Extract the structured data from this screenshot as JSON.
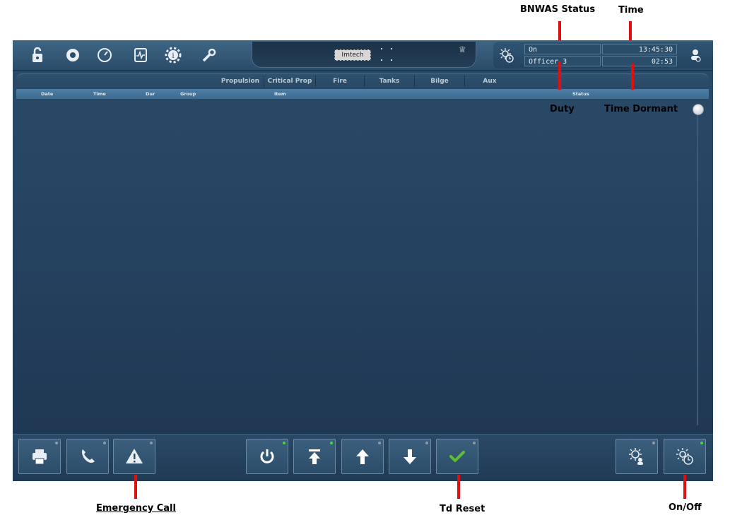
{
  "annotations": {
    "bnwas_status": "BNWAS Status",
    "time": "Time",
    "duty": "Duty",
    "time_dormant": "Time Dormant",
    "emergency_call": "Emergency Call",
    "td_reset": "Td Reset",
    "on_off": "On/Off"
  },
  "topbar": {
    "icons": [
      "unlock-icon",
      "eye-settings-icon",
      "gauge-icon",
      "diagnostics-icon",
      "info-gear-icon",
      "wrench-settings-icon"
    ],
    "logo_label": "Imtech",
    "status": {
      "bnwas_state": "On",
      "duty_officer": "Officer 3",
      "clock": "13:45:30",
      "time_dormant": "02:53"
    }
  },
  "tabs": [
    "Propulsion",
    "Critical Prop",
    "Fire",
    "Tanks",
    "Bilge",
    "Aux"
  ],
  "columns": [
    "Date",
    "Time",
    "Dur",
    "Group",
    "Item",
    "Status"
  ],
  "bottom": {
    "buttons": [
      "printer-icon",
      "phone-icon",
      "warning-icon",
      "power-icon",
      "scroll-top-icon",
      "arrow-up-icon",
      "arrow-down-icon",
      "checkmark-icon",
      "settings-user-icon",
      "bnwas-timer-icon"
    ]
  },
  "colors": {
    "screen_bg": "#264563",
    "header_blue": "#4d7ea6",
    "led_green": "#3ddc3d",
    "callout_red": "#e01010",
    "check_green": "#5cc02e"
  }
}
